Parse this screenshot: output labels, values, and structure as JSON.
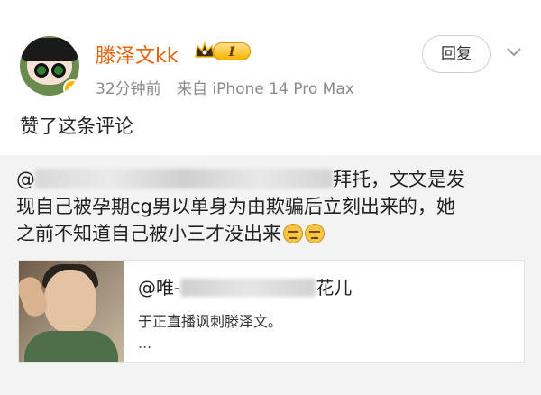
{
  "post": {
    "author": {
      "name": "滕泽文kk",
      "vip_level": "I",
      "verified_mark": "v"
    },
    "meta": {
      "time": "32分钟前",
      "source": "来自 iPhone 14 Pro Max"
    },
    "follow_label": "回复",
    "action_text": "赞了这条评论"
  },
  "comment": {
    "prefix": "@",
    "suffix_line1": "拜托，文文是发",
    "line2": "现自己被孕期cg男以单身为由欺骗后立刻出来的，她",
    "line3": "之前不知道自己被小三才没出来"
  },
  "link_card": {
    "title_prefix": "@唯-",
    "title_suffix": "花儿",
    "description": "于正直播讽刺滕泽文。",
    "more": "..."
  },
  "colors": {
    "username": "#e8620a",
    "meta": "#8a8a8a"
  },
  "icons": {
    "more": "chevron-down-icon",
    "vip": "crown-icon"
  }
}
